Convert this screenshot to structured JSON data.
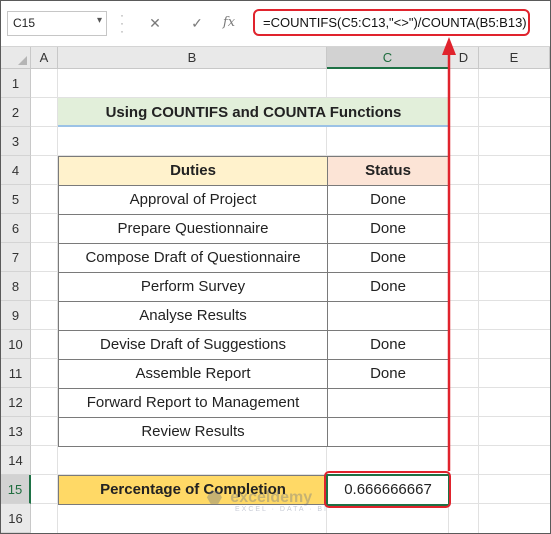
{
  "formula_bar": {
    "name_box": "C15",
    "cancel_icon": "✕",
    "enter_icon": "✓",
    "function_icon": "fx",
    "formula": "=COUNTIFS(C5:C13,\"<>\")/COUNTA(B5:B13)"
  },
  "columns": [
    "A",
    "B",
    "C",
    "D",
    "E"
  ],
  "rows": [
    "1",
    "2",
    "3",
    "4",
    "5",
    "6",
    "7",
    "8",
    "9",
    "10",
    "11",
    "12",
    "13",
    "14",
    "15",
    "16"
  ],
  "sheet": {
    "title": "Using COUNTIFS and COUNTA Functions",
    "headers": {
      "duties": "Duties",
      "status": "Status"
    },
    "table": [
      {
        "duty": "Approval of Project",
        "status": "Done"
      },
      {
        "duty": "Prepare Questionnaire",
        "status": "Done"
      },
      {
        "duty": "Compose Draft of Questionnaire",
        "status": "Done"
      },
      {
        "duty": "Perform Survey",
        "status": "Done"
      },
      {
        "duty": "Analyse Results",
        "status": ""
      },
      {
        "duty": "Devise Draft of Suggestions",
        "status": "Done"
      },
      {
        "duty": "Assemble Report",
        "status": "Done"
      },
      {
        "duty": "Forward Report to Management",
        "status": ""
      },
      {
        "duty": "Review Results",
        "status": ""
      }
    ],
    "completion_label": "Percentage of Completion",
    "completion_value": "0.666666667"
  },
  "watermark": {
    "name": "exceldemy",
    "tagline": "EXCEL · DATA · BI"
  },
  "colors": {
    "accent_red": "#e0232d",
    "excel_green": "#1e7145",
    "title_fill": "#e2efda",
    "duties_fill": "#fff2cc",
    "status_fill": "#fce4d6",
    "completion_fill": "#ffd966"
  }
}
